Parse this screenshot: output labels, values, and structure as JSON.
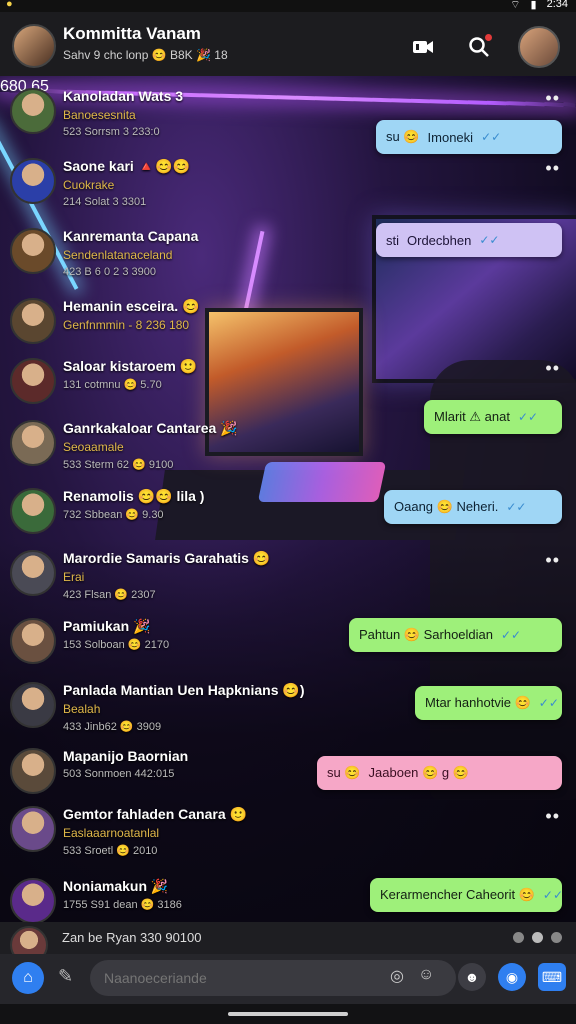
{
  "status_bar": {
    "left_icon": "notification-dot",
    "time": "2:34"
  },
  "header": {
    "title": "Kommitta Vanam",
    "subtitle": "Sahv 9 chc lonp 😊 B8K 🎉 18",
    "icons": [
      "video-icon",
      "search-icon",
      "profile-avatar"
    ]
  },
  "rows": [
    {
      "name": "Kanoladan Wats 3",
      "preview": "Banoesesnita",
      "meta": "523 Sorrsm 3 233:0",
      "avatar_color": "#4b6b3a",
      "initials": "K",
      "bubble": {
        "text": "Imoneki",
        "style": "blue",
        "prefix": "su 😊"
      }
    },
    {
      "name": "Saone kari 🔺😊😊",
      "preview": "Cuokrake",
      "meta": "214 Solat 3 3301",
      "avatar_color": "#2b3fa8",
      "initials": "S"
    },
    {
      "name": "Kanremanta Capana",
      "preview": "Sendenlatanaceland",
      "meta": "423 B 6 0 2 3 3900",
      "avatar_color": "#6a4a2a",
      "initials": "K",
      "bubble": {
        "text": "Ordecbhen",
        "style": "lav",
        "prefix": "sti"
      }
    },
    {
      "name": "Hemanin esceira. 😊",
      "preview": "Genfnmmin - 8 236 180",
      "meta": "",
      "avatar_color": "#5a4630",
      "initials": "H"
    },
    {
      "name": "Saloar kistaroem 🙂",
      "preview": "",
      "meta": "131 cotmnu 😊 5.70",
      "avatar_color": "#5c2a2a",
      "initials": "S"
    },
    {
      "name": "Ganrkakaloar Cantarea 🎉",
      "preview": "Seoaamale",
      "meta": "533 Sterm 62 😊 9100",
      "avatar_color": "#7a6a55",
      "initials": "G",
      "bubble": {
        "text": "Mlarit ⚠ anat",
        "style": "green",
        "prefix": ""
      }
    },
    {
      "name": "Renamolis 😊😊 lila )",
      "preview": "",
      "meta": "732 Sbbean 😊 9.30",
      "avatar_color": "#3a6a3a",
      "initials": "R",
      "bubble": {
        "text": "Oaang 😊 Neheri.",
        "style": "blue",
        "prefix": ""
      }
    },
    {
      "name": "Marordie Samaris Garahatis 😊",
      "preview": "Erai",
      "meta": "423 Flsan 😊 2307",
      "avatar_color": "#4a4a55",
      "initials": "M"
    },
    {
      "name": "Pamiukan 🎉",
      "preview": "",
      "meta": "153 Solboan 😊 2170",
      "avatar_color": "#6a5040",
      "initials": "P",
      "bubble": {
        "text": "Pahtun 😊 Sarhoeldian",
        "style": "green",
        "prefix": ""
      }
    },
    {
      "name": "Panlada Mantian Uen Hapknians 😊)",
      "preview": "Bealah",
      "meta": "433 Jinb62 😊 3909",
      "avatar_color": "#3a3a44",
      "initials": "P",
      "bubble": {
        "text": "Mtar hanhotvie 😊",
        "style": "green",
        "prefix": ""
      }
    },
    {
      "name": "Mapanijo Baornian",
      "preview": "",
      "meta": "503 Sonmoen 442:015",
      "avatar_color": "#5a4a3a",
      "initials": "M",
      "bubble": {
        "text": "Jaaboen 😊 g 😊",
        "style": "pink",
        "prefix": "su 😊"
      }
    },
    {
      "name": "Gemtor fahladen Canara 🙂",
      "preview": "Easlaaarnoatanlal",
      "meta": "533 Sroetl 😊 2010",
      "avatar_color": "#6a4a8a",
      "initials": "G"
    },
    {
      "name": "Noniamakun 🎉",
      "preview": "",
      "meta": "1755 S91 dean 😊 3186",
      "avatar_color": "#5a2a8a",
      "initials": "N",
      "bubble": {
        "text": "Kerarmencher Caheorit 😊",
        "style": "green",
        "prefix": ""
      },
      "time": "680 65"
    }
  ],
  "last_row": {
    "name": "Zan be Ryan 330 90100",
    "avatar_color": "#6a3a3a",
    "initials": "Z"
  },
  "composer": {
    "placeholder": "Naanoeceriande"
  }
}
